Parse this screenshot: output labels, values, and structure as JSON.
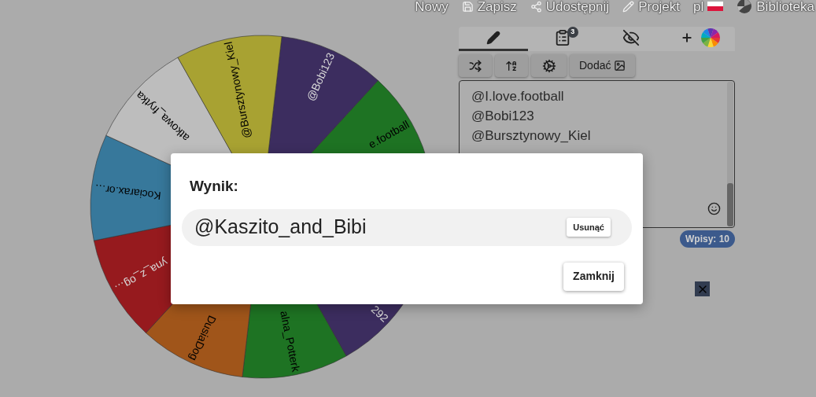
{
  "nav": [
    {
      "kind": "new",
      "label": "Nowy"
    },
    {
      "kind": "save",
      "label": "Zapisz"
    },
    {
      "kind": "share",
      "label": "Udostępnij"
    },
    {
      "kind": "design",
      "label": "Projekt"
    },
    {
      "kind": "language",
      "label": "pl"
    },
    {
      "kind": "library",
      "label": "Biblioteka"
    }
  ],
  "wheel": {
    "segments": [
      {
        "label": "@Bobi123",
        "color": "#3c2d5f"
      },
      {
        "label": "e.football",
        "color": "#1e7323"
      },
      {
        "label": "292",
        "color": "#3c2d5f"
      },
      {
        "label": "alna_Potterk",
        "color": "#1e7323"
      },
      {
        "label": "DusiaDog",
        "color": "#a0551a"
      },
      {
        "label": "yna_z_og…",
        "color": "#961a1e"
      },
      {
        "label": "Kociarax.or…",
        "color": "#37789b"
      },
      {
        "label": "atkowa_frytka",
        "color": "#bdbdbd"
      },
      {
        "label": "@Bursztynowy_Kiel",
        "color": "#a8a232"
      }
    ]
  },
  "panel": {
    "tabs": [
      {
        "kind": "edit",
        "selected": true
      },
      {
        "kind": "results",
        "selected": false,
        "badge": "3"
      },
      {
        "kind": "hide",
        "selected": false
      },
      {
        "kind": "theme",
        "selected": false
      }
    ],
    "toolbar": [
      {
        "kind": "shuffle"
      },
      {
        "kind": "sort"
      },
      {
        "kind": "settings"
      },
      {
        "kind": "add-image",
        "label": "Dodać"
      }
    ],
    "entries": [
      "@I.love.football",
      "@Bobi123",
      "@Bursztynowy_Kiel"
    ],
    "count": "Wpisy: 10"
  },
  "dialog": {
    "title": "Wynik:",
    "result": "@Kaszito_and_Bibi",
    "remove_button": "Usunąć",
    "close_button": "Zamknij"
  }
}
